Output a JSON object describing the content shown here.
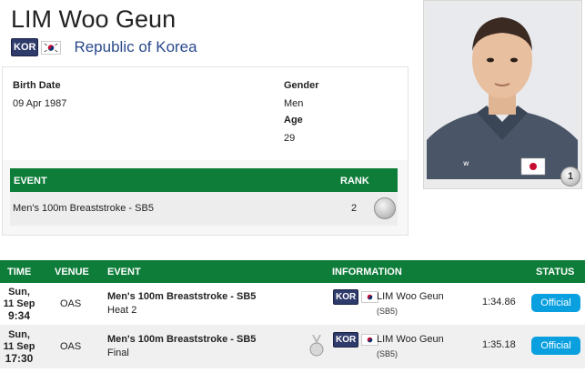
{
  "athlete": {
    "name": "LIM Woo Geun",
    "noc": "KOR",
    "country": "Republic of Korea",
    "medal_count": "1"
  },
  "bio": {
    "birth_date_label": "Birth Date",
    "birth_date": "09 Apr 1987",
    "gender_label": "Gender",
    "gender": "Men",
    "age_label": "Age",
    "age": "29"
  },
  "results": {
    "headers": {
      "event": "EVENT",
      "rank": "RANK"
    },
    "rows": [
      {
        "event": "Men's 100m Breaststroke - SB5",
        "rank": "2",
        "medal": "silver"
      }
    ]
  },
  "schedule": {
    "headers": {
      "time": "TIME",
      "venue": "VENUE",
      "event": "EVENT",
      "information": "INFORMATION",
      "status": "STATUS"
    },
    "rows": [
      {
        "day": "Sun,",
        "date": "11 Sep",
        "time": "9:34",
        "venue": "OAS",
        "event": "Men's 100m Breaststroke - SB5",
        "phase": "Heat 2",
        "noc": "KOR",
        "athlete": "LIM Woo Geun",
        "class": "(SB5)",
        "result": "1:34.86",
        "status": "Official"
      },
      {
        "day": "Sun,",
        "date": "11 Sep",
        "time": "17:30",
        "venue": "OAS",
        "event": "Men's 100m Breaststroke - SB5",
        "phase": "Final",
        "noc": "KOR",
        "athlete": "LIM Woo Geun",
        "class": "(SB5)",
        "result": "1:35.18",
        "status": "Official"
      }
    ]
  },
  "icons": {
    "flag": "korea-flag-icon",
    "medal": "silver-medal-icon"
  },
  "colors": {
    "header_green": "#0f7d3a",
    "status_blue": "#0aa0e0",
    "country_link": "#2a4a8c"
  }
}
